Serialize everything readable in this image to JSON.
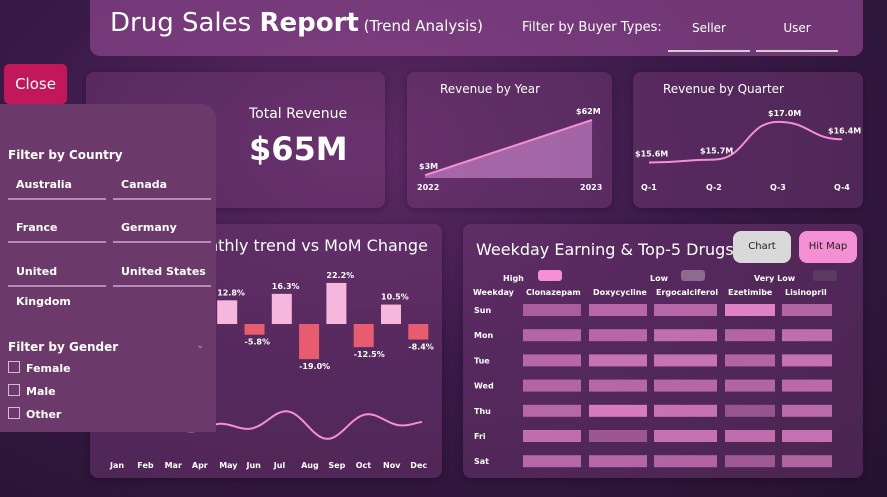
{
  "header": {
    "title_part1": "Drug Sales ",
    "title_bold": "Report",
    "title_sub": " (Trend Analysis)",
    "filter_label": "Filter by Buyer Types:",
    "buyer_types": [
      "Seller",
      "User"
    ]
  },
  "close_label": "Close",
  "filters": {
    "country_heading": "Filter by Country",
    "countries": [
      "Australia",
      "Canada",
      "France",
      "Germany",
      "United Kingdom",
      "United States"
    ],
    "gender_heading": "Filter by Gender",
    "genders": [
      "Female",
      "Male",
      "Other"
    ]
  },
  "kpi": {
    "label": "Total Revenue",
    "value": "$65M"
  },
  "monthly": {
    "title_visible": "nthly trend vs MoM Change",
    "months": [
      "Jan",
      "Feb",
      "Mar",
      "Apr",
      "May",
      "Jun",
      "Jul",
      "Aug",
      "Sep",
      "Oct",
      "Nov",
      "Dec"
    ]
  },
  "weekday": {
    "title": "Weekday Earning & Top-5 Drugs",
    "chart_btn": "Chart",
    "hitmap_btn": "Hit Map",
    "legend": [
      {
        "label": "High",
        "color": "#f48fd4"
      },
      {
        "label": "Low",
        "color": "#8e6a8e"
      },
      {
        "label": "Very Low",
        "color": "#5a3a5e"
      }
    ],
    "weekday_header": "Weekday",
    "drugs": [
      "Clonazepam",
      "Doxycycline",
      "Ergocalciferol",
      "Ezetimibe",
      "Lisinopril"
    ],
    "days": [
      "Sun",
      "Mon",
      "Tue",
      "Wed",
      "Thu",
      "Fri",
      "Sat"
    ]
  },
  "colors": {
    "accent_pink": "#f48fd4",
    "negative_red": "#e85c6f",
    "close_button": "#c2185b"
  },
  "chart_data": [
    {
      "type": "area",
      "title": "Revenue by Year",
      "categories": [
        "2022",
        "2023"
      ],
      "values": [
        3,
        62
      ],
      "value_labels": [
        "$3M",
        "$62M"
      ]
    },
    {
      "type": "line",
      "title": "Revenue by Quarter",
      "categories": [
        "Q-1",
        "Q-2",
        "Q-3",
        "Q-4"
      ],
      "values": [
        15.6,
        15.7,
        17.0,
        16.4
      ],
      "value_labels": [
        "$15.6M",
        "$15.7M",
        "$17.0M",
        "$16.4M"
      ]
    },
    {
      "type": "bar",
      "title": "nthly trend vs MoM Change",
      "categories": [
        "May",
        "Jun",
        "Jul",
        "Aug",
        "Sep",
        "Oct",
        "Nov",
        "Dec"
      ],
      "values": [
        12.8,
        -5.8,
        16.3,
        -19.0,
        22.2,
        -12.5,
        10.5,
        -8.4
      ],
      "value_labels": [
        "12.8%",
        "-5.8%",
        "16.3%",
        "-19.0%",
        "22.2%",
        "-12.5%",
        "10.5%",
        "-8.4%"
      ]
    },
    {
      "type": "heatmap",
      "title": "Weekday Earning & Top-5 Drugs",
      "rows": [
        "Sun",
        "Mon",
        "Tue",
        "Wed",
        "Thu",
        "Fri",
        "Sat"
      ],
      "columns": [
        "Clonazepam",
        "Doxycycline",
        "Ergocalciferol",
        "Ezetimibe",
        "Lisinopril"
      ],
      "values": [
        [
          0.45,
          0.6,
          0.6,
          1.0,
          0.55
        ],
        [
          0.55,
          0.6,
          0.7,
          0.55,
          0.7
        ],
        [
          0.6,
          0.75,
          0.75,
          0.55,
          0.75
        ],
        [
          0.55,
          0.6,
          0.6,
          0.55,
          0.65
        ],
        [
          0.6,
          0.9,
          0.75,
          0.3,
          0.65
        ],
        [
          0.7,
          0.35,
          0.75,
          0.7,
          0.75
        ],
        [
          0.6,
          0.6,
          0.55,
          0.4,
          0.55
        ]
      ]
    }
  ]
}
